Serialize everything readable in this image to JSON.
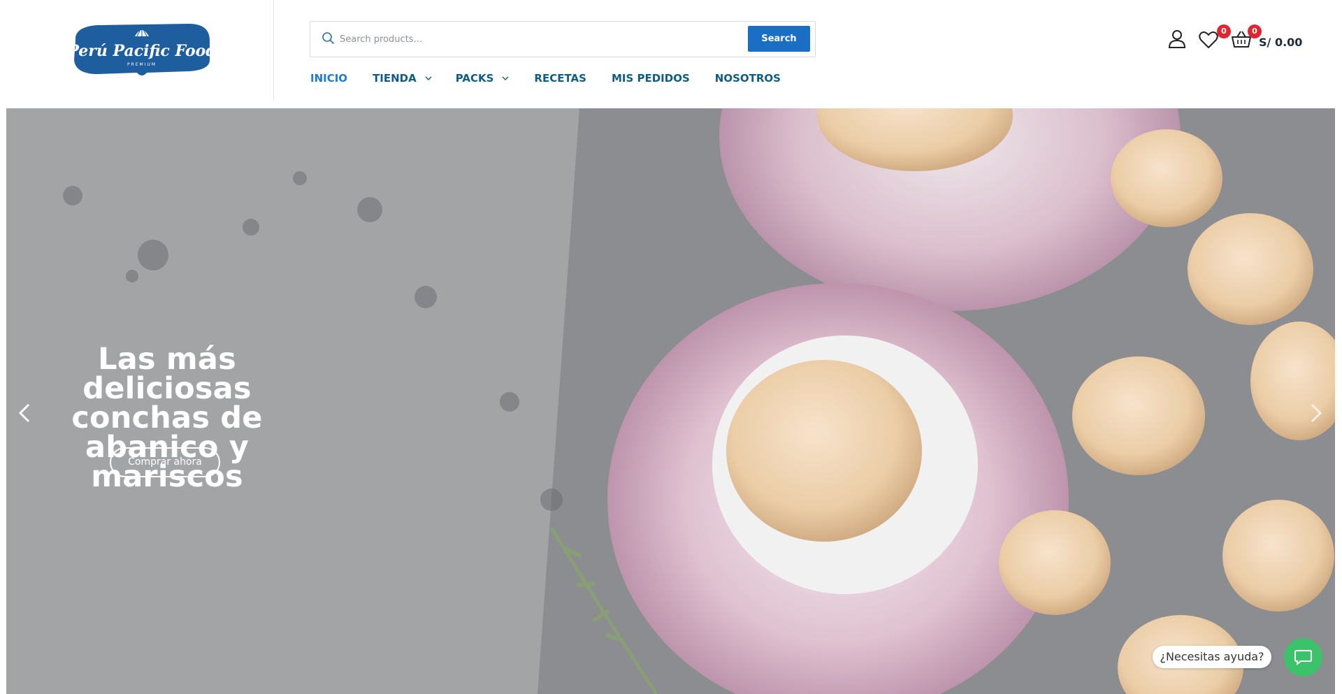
{
  "brand": {
    "name": "Perú Pacific Food",
    "tagline": "PREMIUM",
    "logo_color": "#1f5e9e"
  },
  "search": {
    "placeholder": "Search products...",
    "button_label": "Search",
    "icon": "search-icon"
  },
  "nav": {
    "items": [
      {
        "label": "INICIO",
        "active": true,
        "dropdown": false
      },
      {
        "label": "TIENDA",
        "active": false,
        "dropdown": true
      },
      {
        "label": "PACKS",
        "active": false,
        "dropdown": true
      },
      {
        "label": "RECETAS",
        "active": false,
        "dropdown": false
      },
      {
        "label": "MIS PEDIDOS",
        "active": false,
        "dropdown": false
      },
      {
        "label": "NOSOTROS",
        "active": false,
        "dropdown": false
      }
    ]
  },
  "header_icons": {
    "user": "user-icon",
    "wishlist": {
      "icon": "heart-icon",
      "count": "0"
    },
    "cart": {
      "icon": "basket-icon",
      "count": "0"
    },
    "currency": "S/",
    "cart_total": "0.00"
  },
  "hero": {
    "title": "Las más deliciosas conchas de abanico y mariscos",
    "cta_label": "Comprar ahora",
    "prev_icon": "chevron-left-icon",
    "next_icon": "chevron-right-icon"
  },
  "help_widget": {
    "label": "¿Necesitas ayuda?",
    "icon": "chat-icon",
    "color": "#3cc26b"
  },
  "colors": {
    "accent": "#1a6fc4",
    "nav_text": "#0f5c85",
    "badge": "#e0272f"
  }
}
